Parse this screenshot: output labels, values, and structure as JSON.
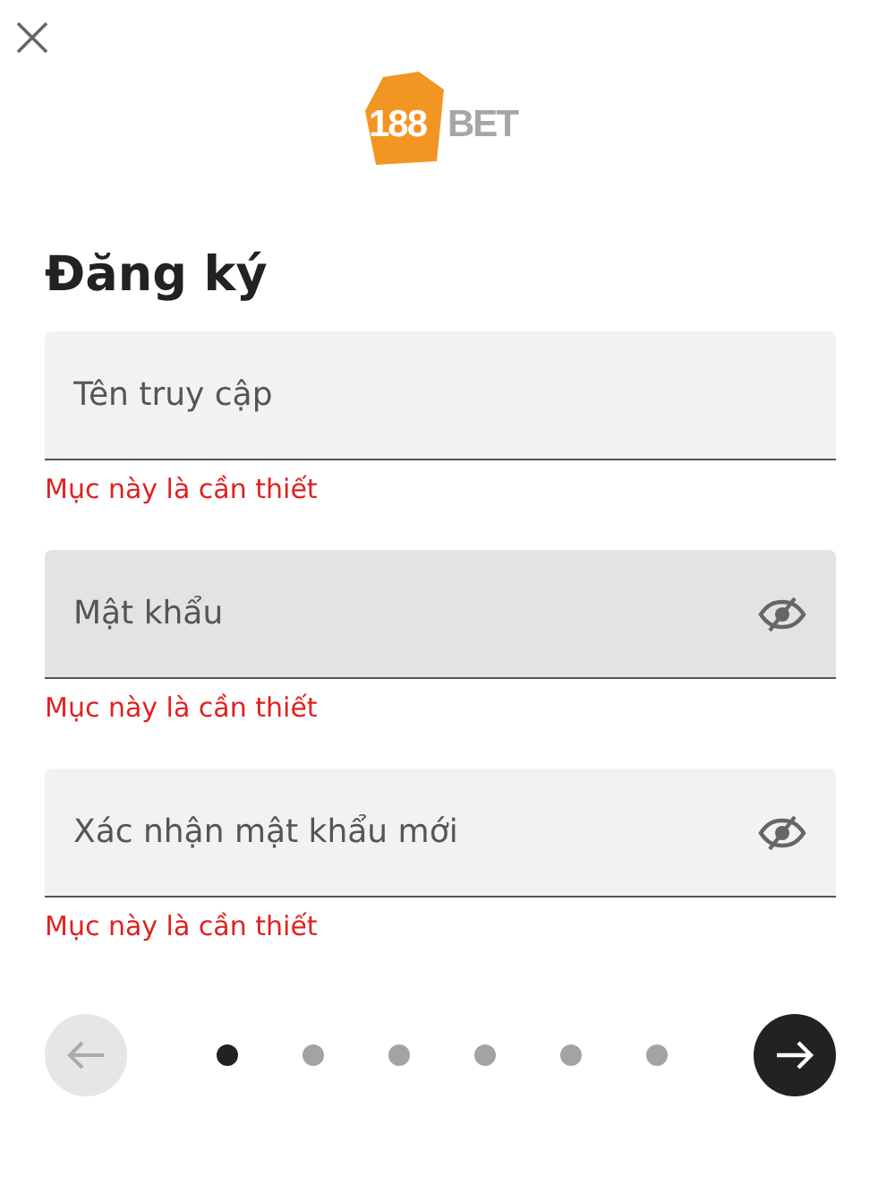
{
  "logo": {
    "number": "188",
    "suffix": "BET"
  },
  "title": "Đăng ký",
  "fields": [
    {
      "placeholder": "Tên truy cập",
      "kind": "text",
      "focused": false,
      "error": "Mục này là cần thiết"
    },
    {
      "placeholder": "Mật khẩu",
      "kind": "password",
      "focused": true,
      "error": "Mục này là cần thiết"
    },
    {
      "placeholder": "Xác nhận mật khẩu mới",
      "kind": "password",
      "focused": false,
      "error": "Mục này là cần thiết"
    }
  ],
  "navigation": {
    "back_disabled": true,
    "next_disabled": false,
    "steps": [
      {
        "selected": true
      },
      {
        "selected": false
      },
      {
        "selected": false
      },
      {
        "selected": false
      },
      {
        "selected": false
      },
      {
        "selected": false
      }
    ]
  }
}
